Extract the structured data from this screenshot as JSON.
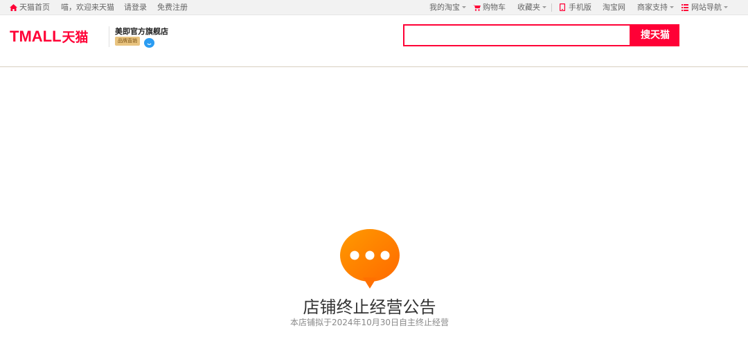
{
  "topbar": {
    "home": "天猫首页",
    "welcome": "喵，欢迎来天猫",
    "login": "请登录",
    "register": "免费注册",
    "my_taobao": "我的淘宝",
    "cart": "购物车",
    "favorites": "收藏夹",
    "mobile": "手机版",
    "taobao": "淘宝网",
    "merchant": "商家支持",
    "site_nav": "网站导航"
  },
  "header": {
    "logo_text": "TMALL",
    "logo_cn": "天猫",
    "shop_name": "美即官方旗舰店",
    "badge": "品牌直销"
  },
  "search": {
    "placeholder": "",
    "button": "搜天猫"
  },
  "notice": {
    "title": "店铺终止经营公告",
    "subtitle": "本店铺拟于2024年10月30日自主终止经营"
  },
  "colors": {
    "brand": "#ff0036",
    "icon_orange": "#ff7a00"
  }
}
